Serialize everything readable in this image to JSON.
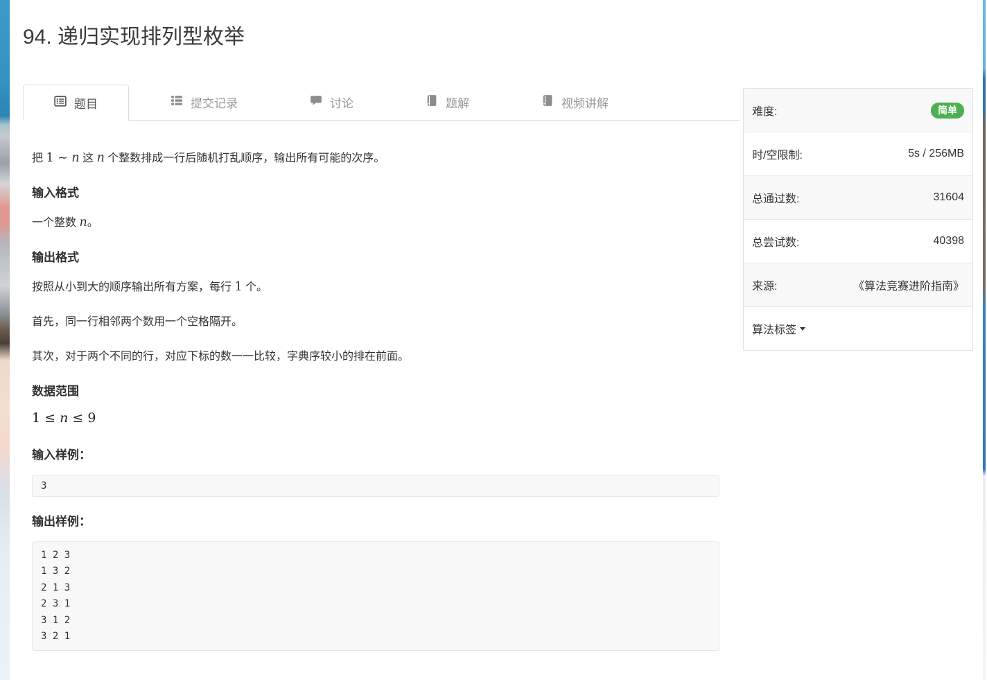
{
  "page": {
    "title": "94. 递归实现排列型枚举"
  },
  "tabs": [
    {
      "label": "题目",
      "icon": "list-alt-icon",
      "active": true
    },
    {
      "label": "提交记录",
      "icon": "list-icon",
      "active": false
    },
    {
      "label": "讨论",
      "icon": "comment-icon",
      "active": false
    },
    {
      "label": "题解",
      "icon": "book-icon",
      "active": false
    },
    {
      "label": "视频讲解",
      "icon": "book-icon",
      "active": false
    }
  ],
  "problem": {
    "statement": [
      "把 ",
      "1",
      " ∼ ",
      "n",
      " 这 ",
      "n",
      " 个整数排成一行后随机打乱顺序，输出所有可能的次序。"
    ],
    "input_format_heading": "输入格式",
    "input_format": [
      "一个整数 ",
      "n",
      "。"
    ],
    "output_format_heading": "输出格式",
    "output_format_p1": [
      "按照从小到大的顺序输出所有方案，每行 ",
      "1",
      " 个。"
    ],
    "output_format_p2": "首先，同一行相邻两个数用一个空格隔开。",
    "output_format_p3": "其次，对于两个不同的行，对应下标的数一一比较，字典序较小的排在前面。",
    "range_heading": "数据范围",
    "range_formula": [
      "1",
      " ≤ ",
      "n",
      " ≤ ",
      "9"
    ],
    "sample_input_heading": "输入样例：",
    "sample_input": "3",
    "sample_output_heading": "输出样例：",
    "sample_output": "1 2 3\n1 3 2\n2 1 3\n2 3 1\n3 1 2\n3 2 1"
  },
  "sidebar": {
    "rows": [
      {
        "label": "难度:",
        "value": "简单",
        "type": "badge"
      },
      {
        "label": "时/空限制:",
        "value": "5s / 256MB",
        "type": "text"
      },
      {
        "label": "总通过数:",
        "value": "31604",
        "type": "text"
      },
      {
        "label": "总尝试数:",
        "value": "40398",
        "type": "text"
      },
      {
        "label": "来源:",
        "value": "《算法竞赛进阶指南》",
        "type": "text"
      },
      {
        "label": "算法标签",
        "value": "",
        "type": "dropdown"
      }
    ],
    "difficulty_badge_color": "#4caf50"
  }
}
